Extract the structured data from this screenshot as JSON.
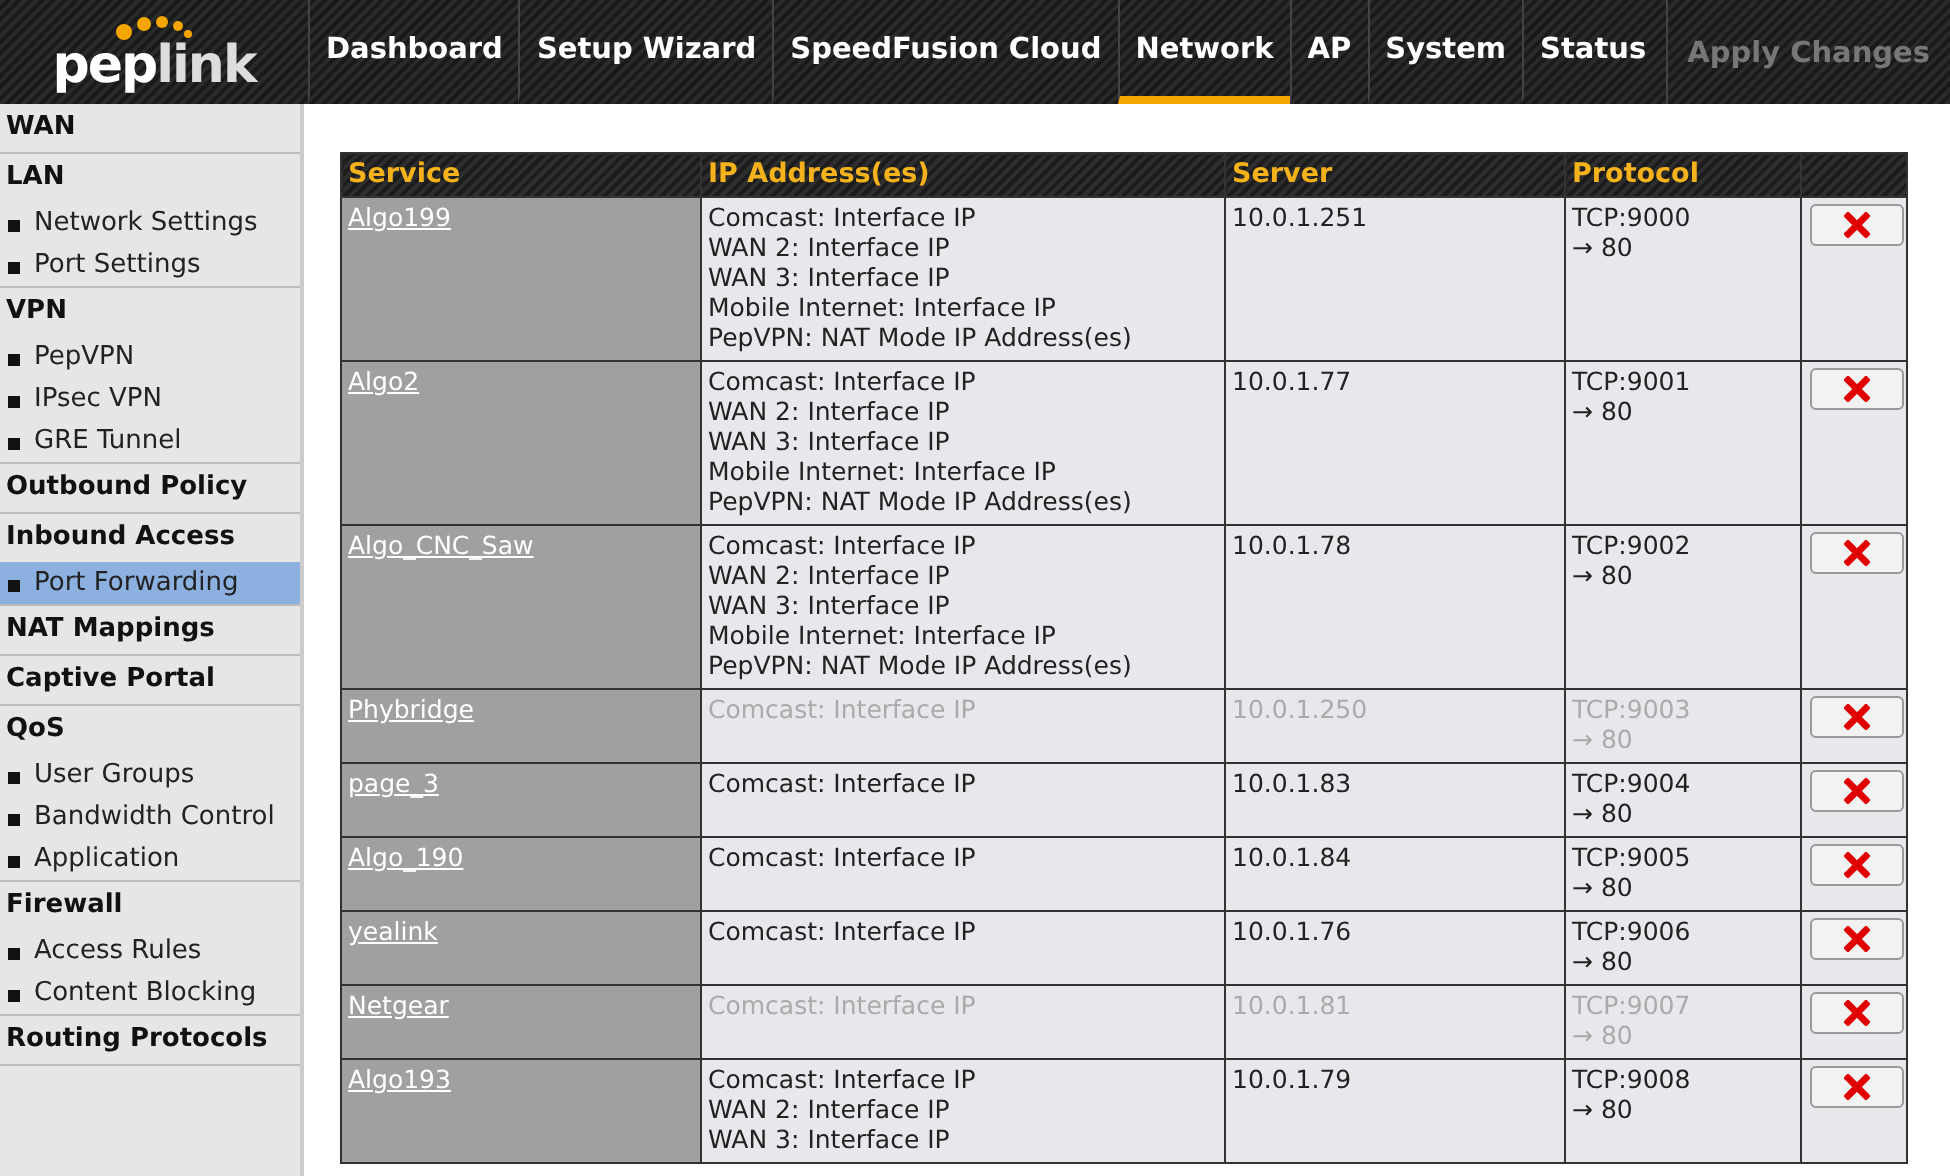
{
  "nav": {
    "logo": [
      "pep",
      "link"
    ],
    "tabs": [
      {
        "label": "Dashboard",
        "selected": false
      },
      {
        "label": "Setup Wizard",
        "selected": false
      },
      {
        "label": "SpeedFusion Cloud",
        "selected": false
      },
      {
        "label": "Network",
        "selected": true
      },
      {
        "label": "AP",
        "selected": false
      },
      {
        "label": "System",
        "selected": false
      },
      {
        "label": "Status",
        "selected": false
      }
    ],
    "apply_button": {
      "label": "Apply Changes",
      "disabled": true
    }
  },
  "sidebar": [
    {
      "label": "WAN"
    },
    {
      "label": "LAN",
      "items": [
        {
          "label": "Network Settings",
          "selected": false
        },
        {
          "label": "Port Settings",
          "selected": false
        }
      ]
    },
    {
      "label": "VPN",
      "items": [
        {
          "label": "PepVPN",
          "selected": false
        },
        {
          "label": "IPsec VPN",
          "selected": false
        },
        {
          "label": "GRE Tunnel",
          "selected": false
        }
      ]
    },
    {
      "label": "Outbound Policy"
    },
    {
      "label": "Inbound Access",
      "items": [
        {
          "label": "Port Forwarding",
          "selected": true
        }
      ]
    },
    {
      "label": "NAT Mappings"
    },
    {
      "label": "Captive Portal"
    },
    {
      "label": "QoS",
      "items": [
        {
          "label": "User Groups",
          "selected": false
        },
        {
          "label": "Bandwidth Control",
          "selected": false
        },
        {
          "label": "Application",
          "selected": false
        }
      ]
    },
    {
      "label": "Firewall",
      "items": [
        {
          "label": "Access Rules",
          "selected": false
        },
        {
          "label": "Content Blocking",
          "selected": false
        }
      ]
    },
    {
      "label": "Routing Protocols"
    }
  ],
  "table": {
    "columns": [
      "Service",
      "IP Address(es)",
      "Server",
      "Protocol"
    ],
    "rows": [
      {
        "service": "Algo199",
        "addresses": [
          "Comcast: Interface IP",
          "WAN 2: Interface IP",
          "WAN 3: Interface IP",
          "Mobile Internet: Interface IP",
          "PepVPN: NAT Mode IP Address(es)"
        ],
        "server": "10.0.1.251",
        "protocol": [
          "TCP:9000",
          "→ 80"
        ],
        "enabled": true
      },
      {
        "service": "Algo2",
        "addresses": [
          "Comcast: Interface IP",
          "WAN 2: Interface IP",
          "WAN 3: Interface IP",
          "Mobile Internet: Interface IP",
          "PepVPN: NAT Mode IP Address(es)"
        ],
        "server": "10.0.1.77",
        "protocol": [
          "TCP:9001",
          "→ 80"
        ],
        "enabled": true
      },
      {
        "service": "Algo_CNC_Saw",
        "addresses": [
          "Comcast: Interface IP",
          "WAN 2: Interface IP",
          "WAN 3: Interface IP",
          "Mobile Internet: Interface IP",
          "PepVPN: NAT Mode IP Address(es)"
        ],
        "server": "10.0.1.78",
        "protocol": [
          "TCP:9002",
          "→ 80"
        ],
        "enabled": true
      },
      {
        "service": "Phybridge",
        "addresses": [
          "Comcast: Interface IP"
        ],
        "server": "10.0.1.250",
        "protocol": [
          "TCP:9003",
          "→ 80"
        ],
        "enabled": false
      },
      {
        "service": "page_3",
        "addresses": [
          "Comcast: Interface IP"
        ],
        "server": "10.0.1.83",
        "protocol": [
          "TCP:9004",
          "→ 80"
        ],
        "enabled": true
      },
      {
        "service": "Algo_190",
        "addresses": [
          "Comcast: Interface IP"
        ],
        "server": "10.0.1.84",
        "protocol": [
          "TCP:9005",
          "→ 80"
        ],
        "enabled": true
      },
      {
        "service": "yealink",
        "addresses": [
          "Comcast: Interface IP"
        ],
        "server": "10.0.1.76",
        "protocol": [
          "TCP:9006",
          "→ 80"
        ],
        "enabled": true
      },
      {
        "service": "Netgear",
        "addresses": [
          "Comcast: Interface IP"
        ],
        "server": "10.0.1.81",
        "protocol": [
          "TCP:9007",
          "→ 80"
        ],
        "enabled": false
      },
      {
        "service": "Algo193",
        "addresses": [
          "Comcast: Interface IP",
          "WAN 2: Interface IP",
          "WAN 3: Interface IP"
        ],
        "server": "10.0.1.79",
        "protocol": [
          "TCP:9008",
          "→ 80"
        ],
        "enabled": true
      }
    ]
  }
}
